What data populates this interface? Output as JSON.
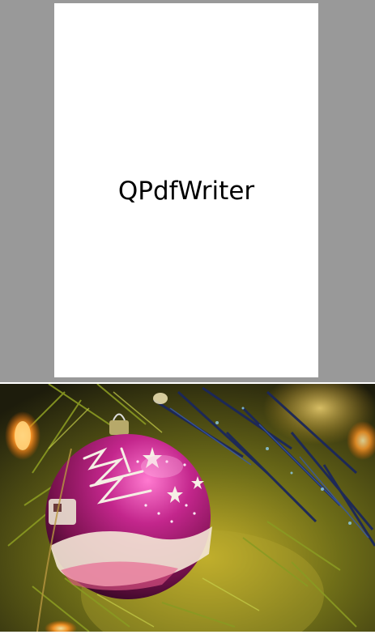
{
  "viewer": {
    "background": "#999999",
    "page_text": "QPdfWriter"
  },
  "photo": {
    "subject": "christmas-ornament-photo",
    "colors": {
      "ornament": "#b0247a",
      "needles": "#7a8a1e",
      "tinsel": "#1e2a60",
      "light": "#ff9a2a"
    }
  }
}
